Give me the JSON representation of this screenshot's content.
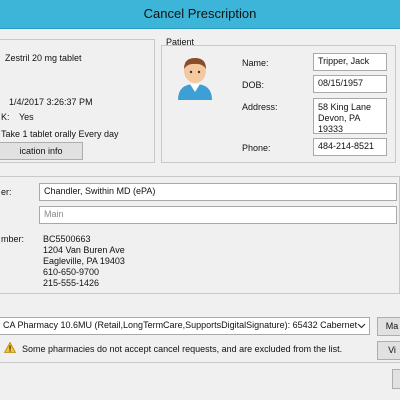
{
  "window": {
    "title": "Cancel Prescription"
  },
  "medication": {
    "name": "Zestril 20 mg tablet",
    "written_date": "1/4/2017 3:26:37 PM",
    "ok_value": "Yes",
    "ok_label": "K:",
    "sig": "Take 1 tablet orally Every day",
    "info_button": "ication info"
  },
  "patient": {
    "section_label": "Patient",
    "name_label": "Name:",
    "name_value": "Tripper, Jack",
    "dob_label": "DOB:",
    "dob_value": "08/15/1957",
    "address_label": "Address:",
    "address_line1": "58 King Lane",
    "address_line2": "Devon, PA 19333",
    "phone_label": "Phone:",
    "phone_value": "484-214-8521"
  },
  "prescriber": {
    "label": "er:",
    "value": "Chandler, Swithin MD (ePA)",
    "location_placeholder": "Main",
    "number_label": "mber:",
    "details": [
      "BC5500663",
      "1204 Van Buren Ave",
      "Eagleville, PA 19403",
      "610-650-9700",
      "215-555-1426"
    ]
  },
  "pharmacy": {
    "selected": "CA Pharmacy 10.6MU (Retail,LongTermCare,SupportsDigitalSignature):  65432 Cabernet",
    "manage_button": "Ma",
    "view_button": "Vi",
    "warning": "Some pharmacies do not accept cancel requests, and are excluded from the list."
  },
  "colors": {
    "titlebar": "#3cb5d8",
    "panel_border": "#c8c8c8"
  }
}
